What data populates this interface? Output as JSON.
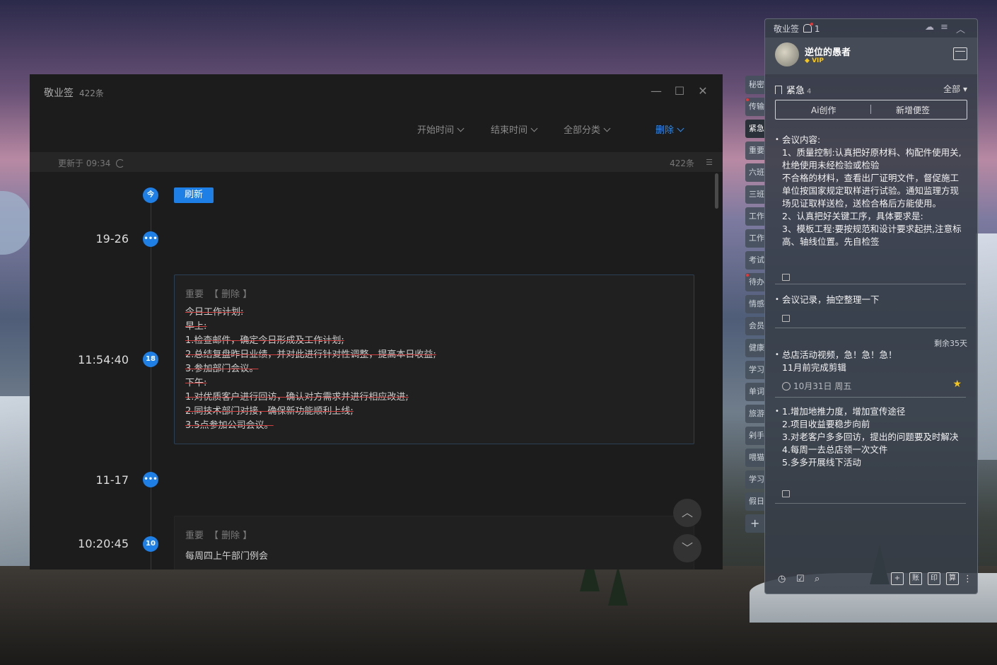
{
  "main": {
    "app_title": "敬业签",
    "count": "422条",
    "filters": {
      "start_time": "开始时间",
      "end_time": "结束时间",
      "all_category": "全部分类",
      "delete": "删除"
    },
    "updated": "更新于 09:34",
    "total": "422条",
    "refresh_button": "刷新",
    "today_label": "今",
    "timeline": [
      {
        "label": "19-26",
        "badge": "•••"
      },
      {
        "label": "11:54:40",
        "badge": "18"
      },
      {
        "label": "11-17",
        "badge": "•••"
      },
      {
        "label": "10:20:45",
        "badge": "10"
      }
    ],
    "card1": {
      "tag": "重要",
      "action": "【 删除 】",
      "lines": [
        "今日工作计划:",
        "早上:",
        "1.检查邮件，确定今日形成及工作计划;",
        "2.总结复盘昨日业绩，并对此进行针对性调整，提高本日收益;",
        "3.参加部门会议。",
        "下午:",
        "1.对优质客户进行回访，确认对方需求并进行相应改进;",
        "2.同技术部门对接，确保新功能顺利上线;",
        "3.5点参加公司会议。"
      ]
    },
    "card2": {
      "tag": "重要",
      "action": "【 删除 】",
      "line": "每周四上午部门例会"
    }
  },
  "side_tabs": [
    "秘密",
    "传输",
    "紧急",
    "重要",
    "六班",
    "三班",
    "工作",
    "工作",
    "考试",
    "待办",
    "情感",
    "会员",
    "健康",
    "学习",
    "单词",
    "旅游",
    "剁手",
    "喂猫",
    "学习",
    "假日"
  ],
  "side_add": "+",
  "panel": {
    "title": "敬业签",
    "notif_count": "1",
    "username": "逆位的愚者",
    "vip": "VIP",
    "category": "紧急",
    "category_count": "4",
    "filter_all": "全部",
    "ai_button": "Ai创作",
    "new_button": "新增便签",
    "notes": [
      {
        "lines": [
          "会议内容:",
          "1、质量控制:认真把好原材料、构配件使用关,杜绝使用未经检验或检验",
          "不合格的材料，查看出厂证明文件，督促施工单位按国家规定取样进行试验。通知监理方现场见证取样送检，送检合格后方能使用。",
          "2、认真把好关键工序，具体要求是:",
          "3、模板工程:要按规范和设计要求起拱,注意标高、轴线位置。先自检签"
        ]
      },
      {
        "lines": [
          "会议记录，抽空整理一下"
        ]
      },
      {
        "remaining": "剩余35天",
        "lines": [
          "总店活动视频，急！急！急！",
          "11月前完成剪辑"
        ],
        "due": "10月31日 周五"
      },
      {
        "lines": [
          "1.增加地推力度，增加宣传途径",
          "2.项目收益要稳步向前",
          "3.对老客户多多回访，提出的问题要及时解决",
          "4.每周一去总店领一次文件",
          "5.多多开展线下活动"
        ]
      }
    ],
    "footer_boxes": [
      "+",
      "账",
      "印",
      "算"
    ]
  }
}
